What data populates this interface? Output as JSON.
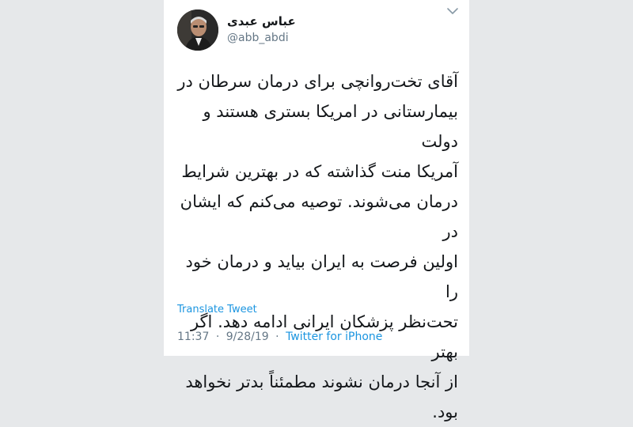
{
  "tweet": {
    "author": {
      "display_name": "عباس عبدی",
      "handle": "@abb_abdi",
      "avatar_icon": "user-avatar-photo"
    },
    "menu_icon": "chevron-down-icon",
    "text": "آقای تخت‌روانچی برای درمان سرطان در\nبیمارستانی در امریکا بستری هستند و دولت\nآمریکا منت گذاشته که در بهترین شرایط\nدرمان می‌شوند. توصیه می‌کنم که ایشان در\nاولین فرصت به ایران بیاید و درمان خود را\nتحت‌نظر پزشکان ایرانی ادامه دهد. اگر بهتر\nاز آنجا درمان نشوند مطمئناً بدتر نخواهد\nبود.",
    "translate_label": "Translate Tweet",
    "time": "11:37",
    "separator": "·",
    "date": "9/28/19",
    "source": "Twitter for iPhone"
  },
  "colors": {
    "background": "#e6e8ea",
    "card": "#ffffff",
    "link": "#1b95e0",
    "muted": "#657786",
    "text": "#14171a"
  }
}
